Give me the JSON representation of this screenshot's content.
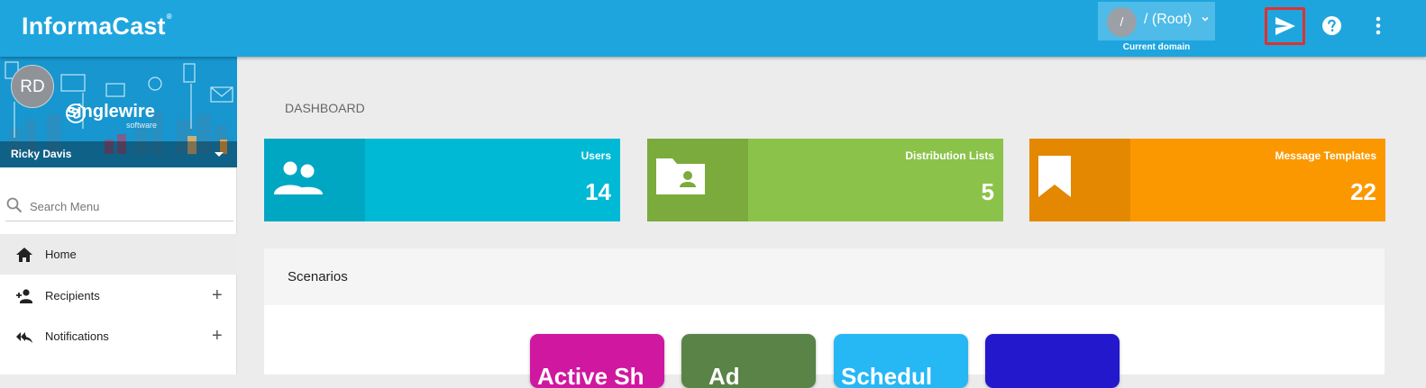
{
  "header": {
    "brand": "InformaCast",
    "brand_mark": "®",
    "domain": {
      "avatar_text": "/",
      "name": "/ (Root)",
      "caption": "Current domain"
    },
    "icons": {
      "send": "send-icon",
      "help": "help-icon",
      "more": "more-vert-icon"
    }
  },
  "sidebar": {
    "user": {
      "initials": "RD",
      "name": "Ricky Davis"
    },
    "banner": {
      "logo": "singlewire",
      "logo_sub": "software"
    },
    "search": {
      "placeholder": "Search Menu"
    },
    "items": [
      {
        "label": "Home",
        "icon": "home-icon",
        "expandable": false,
        "active": true
      },
      {
        "label": "Recipients",
        "icon": "person-add-icon",
        "expandable": true,
        "active": false
      },
      {
        "label": "Notifications",
        "icon": "reply-all-icon",
        "expandable": true,
        "active": false
      }
    ],
    "expand_symbol": "+"
  },
  "main": {
    "title": "DASHBOARD",
    "cards": [
      {
        "title": "Users",
        "count": "14",
        "icon": "users-icon",
        "color": "#00b9d5",
        "icon_bg": "#00a7c3"
      },
      {
        "title": "Distribution Lists",
        "count": "5",
        "icon": "folder-shared-icon",
        "color": "#8bc34a",
        "icon_bg": "#7bab3c"
      },
      {
        "title": "Message Templates",
        "count": "22",
        "icon": "bookmark-icon",
        "color": "#fb9800",
        "icon_bg": "#e38800"
      }
    ],
    "scenarios": {
      "title": "Scenarios",
      "tiles": [
        {
          "label": "Active Sh",
          "color": "#cf179f"
        },
        {
          "label": "Ad",
          "color": "#5a8347"
        },
        {
          "label": "Schedul",
          "color": "#26b7f5"
        },
        {
          "label": "",
          "color": "#2318cc"
        }
      ]
    }
  }
}
